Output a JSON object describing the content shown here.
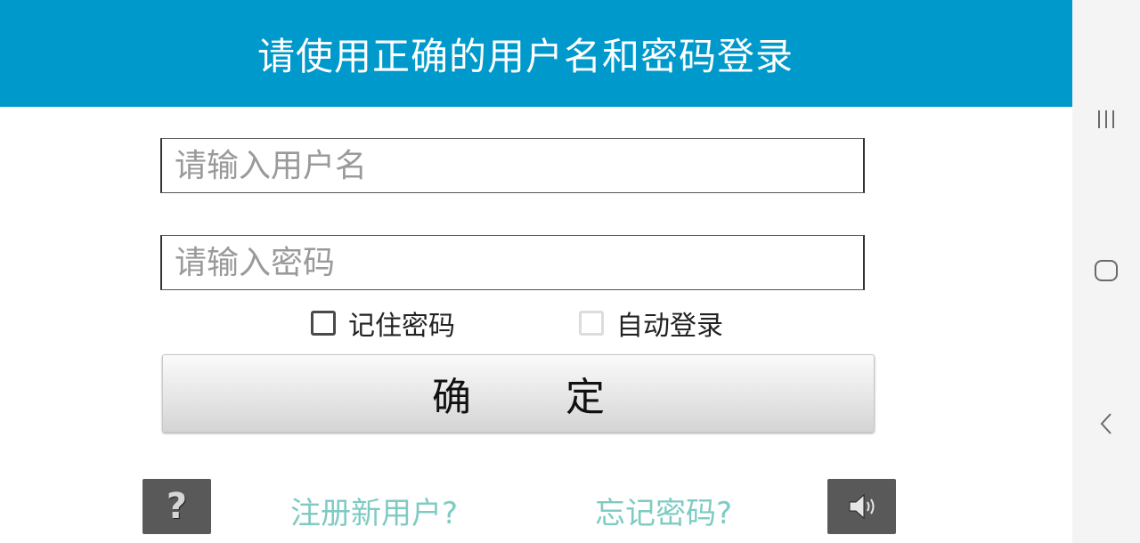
{
  "colors": {
    "header_bg": "#0099cc",
    "link": "#7ecbc3",
    "icon_button_bg": "#595959"
  },
  "header": {
    "title": "请使用正确的用户名和密码登录"
  },
  "form": {
    "username": {
      "value": "",
      "placeholder": "请输入用户名"
    },
    "password": {
      "value": "",
      "placeholder": "请输入密码"
    },
    "remember_password": {
      "label": "记住密码",
      "checked": false
    },
    "auto_login": {
      "label": "自动登录",
      "checked": false,
      "enabled": false
    },
    "confirm_label": "确定"
  },
  "footer": {
    "help_icon": "question-icon",
    "help_glyph": "?",
    "register_link": "注册新用户?",
    "forgot_link": "忘记密码?",
    "sound_icon": "speaker-icon"
  },
  "navbar": {
    "recent_icon": "recent-apps-icon",
    "home_icon": "home-icon",
    "back_icon": "back-icon"
  }
}
